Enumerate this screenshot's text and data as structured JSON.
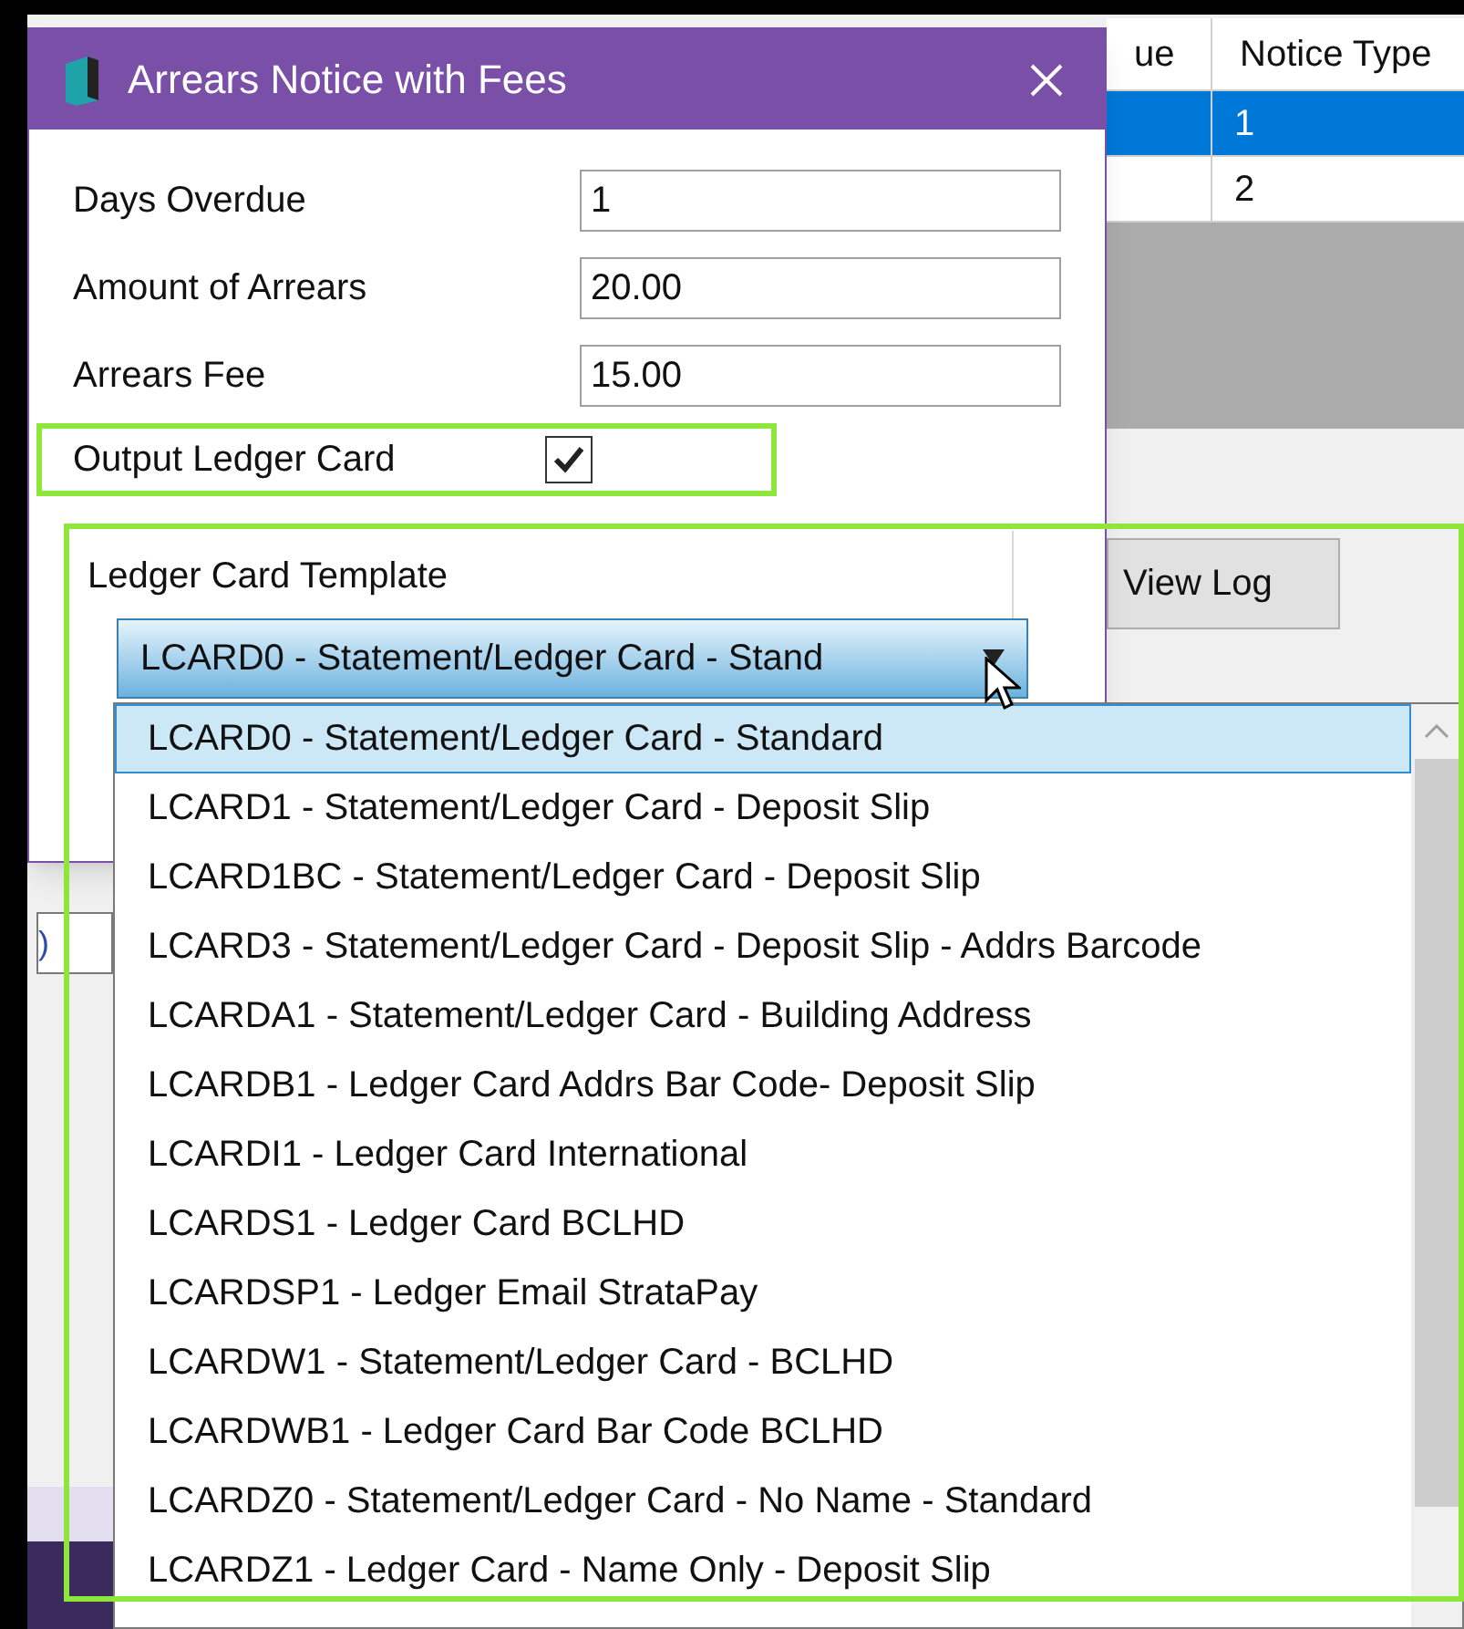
{
  "background_table": {
    "columns": [
      "ue",
      "Notice Type"
    ],
    "rows": [
      {
        "cells": [
          "",
          "1"
        ],
        "selected": true
      },
      {
        "cells": [
          "",
          "2"
        ],
        "selected": false
      }
    ]
  },
  "background_button": "View Log",
  "background_fragment": ")",
  "dialog": {
    "title": "Arrears Notice with Fees",
    "fields": [
      {
        "label": "Days Overdue",
        "value": "1"
      },
      {
        "label": "Amount of Arrears",
        "value": "20.00"
      },
      {
        "label": "Arrears Fee",
        "value": "15.00"
      }
    ],
    "checkbox": {
      "label": "Output Ledger Card",
      "checked": true
    },
    "template": {
      "label": "Ledger Card Template",
      "value": "LCARD0 - Statement/Ledger Card - Stand"
    }
  },
  "dropdown": {
    "options": [
      {
        "label": "LCARD0 - Statement/Ledger Card - Standard",
        "selected": true
      },
      {
        "label": "LCARD1 - Statement/Ledger Card - Deposit Slip",
        "selected": false
      },
      {
        "label": "LCARD1BC - Statement/Ledger Card - Deposit Slip",
        "selected": false
      },
      {
        "label": "LCARD3 - Statement/Ledger Card - Deposit Slip - Addrs Barcode",
        "selected": false
      },
      {
        "label": "LCARDA1 - Statement/Ledger Card - Building Address",
        "selected": false
      },
      {
        "label": "LCARDB1 - Ledger Card Addrs Bar Code- Deposit Slip",
        "selected": false
      },
      {
        "label": "LCARDI1 - Ledger Card International",
        "selected": false
      },
      {
        "label": "LCARDS1 - Ledger Card BCLHD",
        "selected": false
      },
      {
        "label": "LCARDSP1 - Ledger Email StrataPay",
        "selected": false
      },
      {
        "label": "LCARDW1 - Statement/Ledger Card - BCLHD",
        "selected": false
      },
      {
        "label": "LCARDWB1 - Ledger Card Bar Code BCLHD",
        "selected": false
      },
      {
        "label": "LCARDZ0 - Statement/Ledger Card - No Name - Standard",
        "selected": false
      },
      {
        "label": "LCARDZ1 - Ledger Card - Name Only - Deposit Slip",
        "selected": false
      }
    ]
  }
}
